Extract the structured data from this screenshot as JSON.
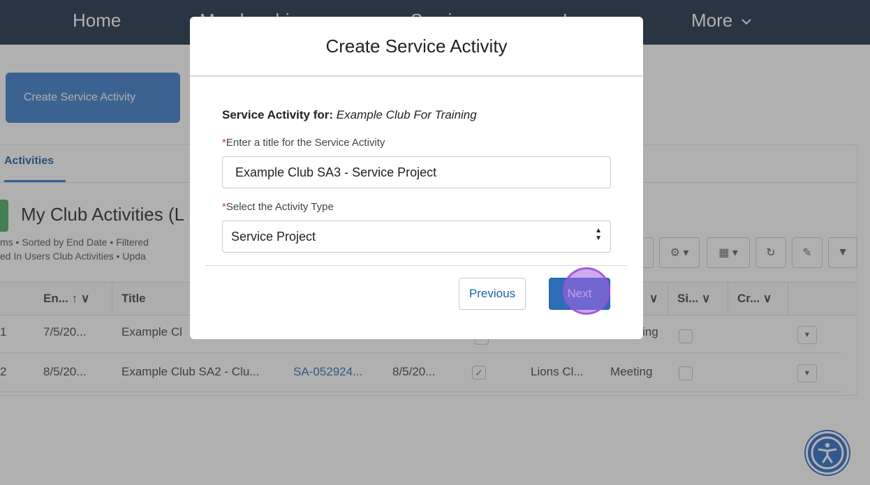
{
  "nav": {
    "items": [
      "Home",
      "Memberships",
      "Service",
      "Learn"
    ],
    "more_label": "More"
  },
  "page": {
    "create_button": "Create Service Activity",
    "tab_label": "Activities",
    "list_title": "My Club Activities (L",
    "list_meta_1": "ms • Sorted by End Date • Filtered",
    "list_meta_2": "ed In Users Club Activities • Upda",
    "columns": {
      "end": "En... ↑",
      "title": "Title",
      "si": "Si...",
      "cr": "Cr..."
    },
    "rows": [
      {
        "num": "1",
        "end": "7/5/20...",
        "title": "Example Cl",
        "name": "",
        "date": "",
        "type_partial": "ing"
      },
      {
        "num": "2",
        "end": "8/5/20...",
        "title": "Example Club SA2 - Clu...",
        "name": "SA-052924...",
        "date": "8/5/20...",
        "club": "Lions Cl...",
        "type": "Meeting"
      }
    ]
  },
  "modal": {
    "title": "Create Service Activity",
    "for_label": "Service Activity for:",
    "for_value": "Example Club For Training",
    "title_field_label": "Enter a title for the Service Activity",
    "title_field_value": "Example Club SA3 - Service Project",
    "type_field_label": "Select the Activity Type",
    "type_field_value": "Service Project",
    "previous_label": "Previous",
    "next_label": "Next"
  },
  "colors": {
    "nav_bg": "#0b1f3a",
    "brand_blue": "#2d72c6",
    "required": "#c23934",
    "click_highlight": "#aa64e6"
  },
  "icons": [
    "chevron-down-icon",
    "sort-up-icon",
    "gear-icon",
    "table-icon",
    "refresh-icon",
    "pencil-icon",
    "filter-icon",
    "checkbox-icon",
    "accessibility-icon",
    "select-arrows-icon"
  ]
}
